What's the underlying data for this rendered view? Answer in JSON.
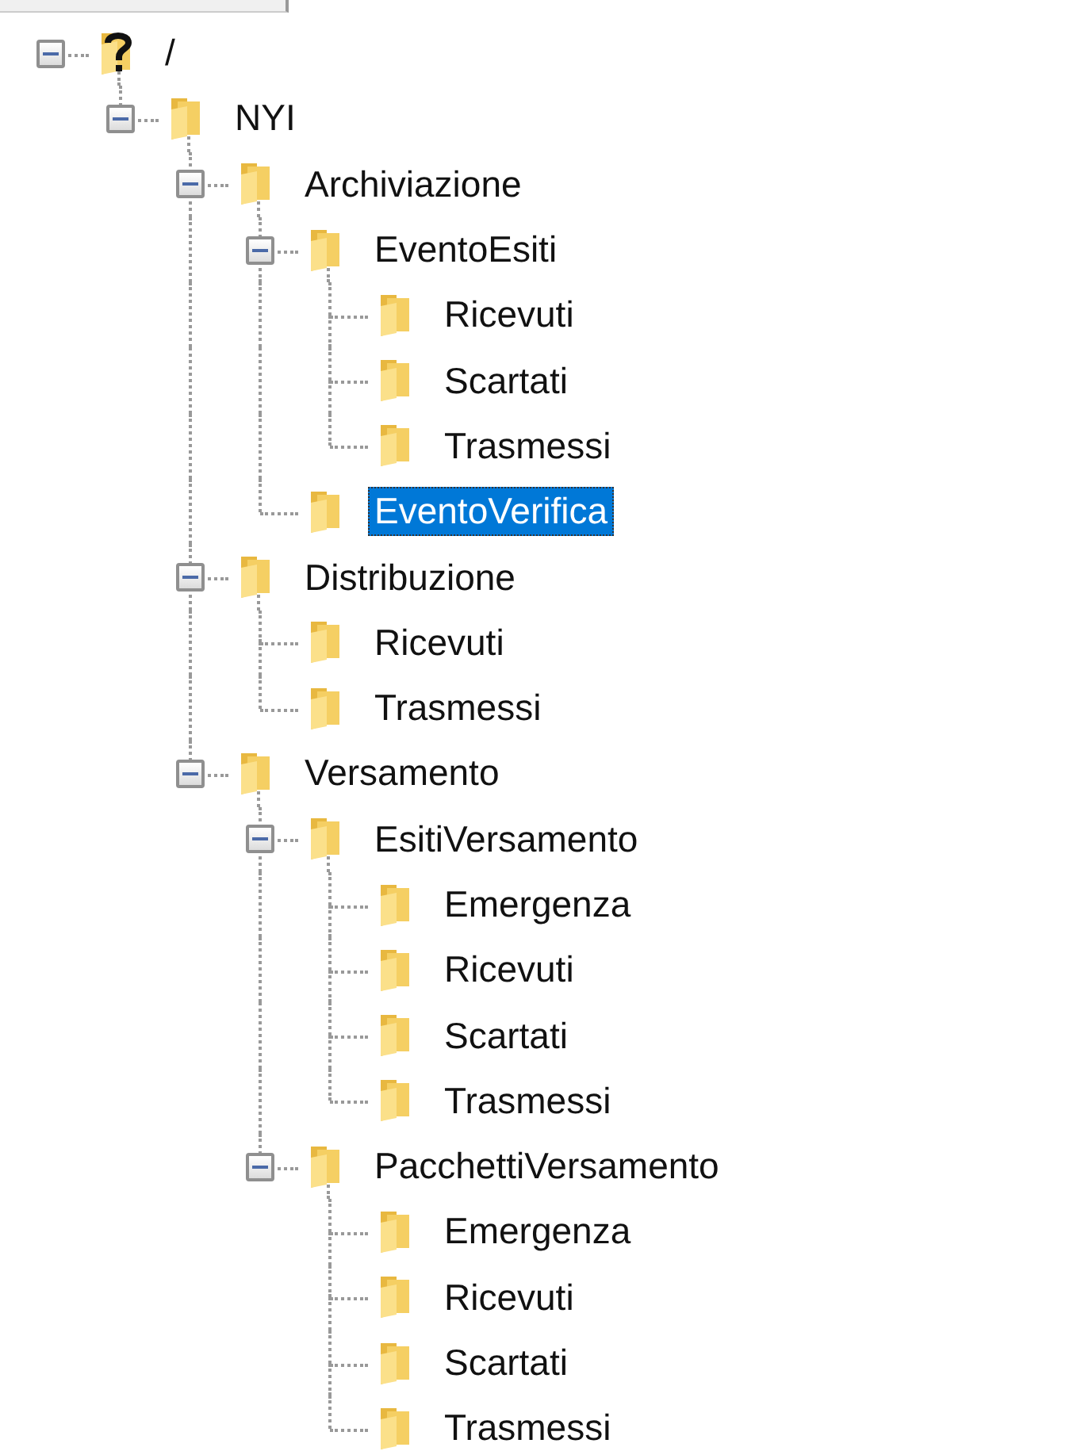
{
  "tree": [
    {
      "label": "/",
      "kind": "unknown",
      "expanded": true,
      "selected": false,
      "children": [
        {
          "label": "NYI",
          "kind": "folder",
          "expanded": true,
          "selected": false,
          "children": [
            {
              "label": "Archiviazione",
              "kind": "folder",
              "expanded": true,
              "selected": false,
              "children": [
                {
                  "label": "EventoEsiti",
                  "kind": "folder",
                  "expanded": true,
                  "selected": false,
                  "children": [
                    {
                      "label": "Ricevuti",
                      "kind": "folder",
                      "selected": false
                    },
                    {
                      "label": "Scartati",
                      "kind": "folder",
                      "selected": false
                    },
                    {
                      "label": "Trasmessi",
                      "kind": "folder",
                      "selected": false
                    }
                  ]
                },
                {
                  "label": "EventoVerifica",
                  "kind": "folder",
                  "selected": true
                }
              ]
            },
            {
              "label": "Distribuzione",
              "kind": "folder",
              "expanded": true,
              "selected": false,
              "children": [
                {
                  "label": "Ricevuti",
                  "kind": "folder",
                  "selected": false
                },
                {
                  "label": "Trasmessi",
                  "kind": "folder",
                  "selected": false
                }
              ]
            },
            {
              "label": "Versamento",
              "kind": "folder",
              "expanded": true,
              "selected": false,
              "children": [
                {
                  "label": "EsitiVersamento",
                  "kind": "folder",
                  "expanded": true,
                  "selected": false,
                  "children": [
                    {
                      "label": "Emergenza",
                      "kind": "folder",
                      "selected": false
                    },
                    {
                      "label": "Ricevuti",
                      "kind": "folder",
                      "selected": false
                    },
                    {
                      "label": "Scartati",
                      "kind": "folder",
                      "selected": false
                    },
                    {
                      "label": "Trasmessi",
                      "kind": "folder",
                      "selected": false
                    }
                  ]
                },
                {
                  "label": "PacchettiVersamento",
                  "kind": "folder",
                  "expanded": true,
                  "selected": false,
                  "children": [
                    {
                      "label": "Emergenza",
                      "kind": "folder",
                      "selected": false
                    },
                    {
                      "label": "Ricevuti",
                      "kind": "folder",
                      "selected": false
                    },
                    {
                      "label": "Scartati",
                      "kind": "folder",
                      "selected": false
                    },
                    {
                      "label": "Trasmessi",
                      "kind": "folder",
                      "selected": false
                    }
                  ]
                }
              ]
            }
          ]
        }
      ]
    }
  ]
}
